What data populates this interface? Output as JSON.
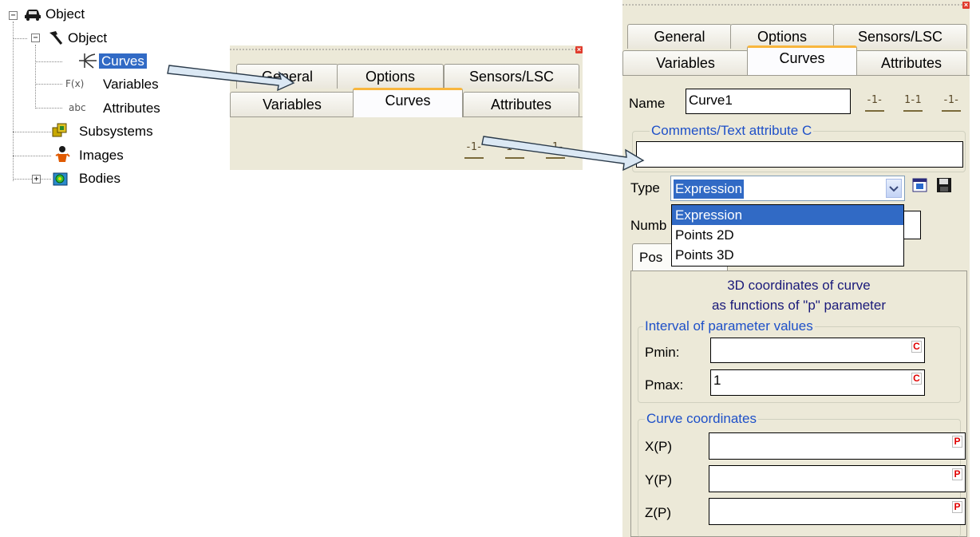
{
  "tree": {
    "nodes": [
      {
        "label": "Object",
        "icon": "car-icon"
      },
      {
        "label": "Object",
        "icon": "hammer-icon"
      },
      {
        "label": "Curves",
        "icon": "curves-icon"
      },
      {
        "label": "Variables",
        "icon": "fx-icon",
        "icon_text": "F(x)"
      },
      {
        "label": "Attributes",
        "icon": "abc-icon",
        "icon_text": "abc"
      },
      {
        "label": "Subsystems",
        "icon": "subsystems-icon"
      },
      {
        "label": "Images",
        "icon": "images-icon"
      },
      {
        "label": "Bodies",
        "icon": "bodies-icon"
      }
    ],
    "expanders": {
      "collapse": "⊟",
      "expand": "+",
      "minus": "−"
    }
  },
  "tabs": {
    "row1": [
      "General",
      "Options",
      "Sensors/LSC"
    ],
    "row2": [
      "Variables",
      "Curves",
      "Attributes"
    ],
    "active": "Curves"
  },
  "toolbar_glyphs": {
    "add": "-1-",
    "add_multi": "1-1",
    "remove": "-1-"
  },
  "close_glyph": "×",
  "form": {
    "name_label": "Name",
    "name_value": "Curve1",
    "comments_title": "Comments/Text attribute C",
    "comments_value": "",
    "type_label": "Type",
    "type_value": "Expression",
    "type_options": [
      "Expression",
      "Points 2D",
      "Points 3D"
    ],
    "number_label_visible": "Numb",
    "subtab_visible": "Pos",
    "description_line1": "3D coordinates of curve",
    "description_line2": "as functions of \"p\" parameter",
    "interval_title": "Interval of parameter values",
    "pmin_label": "Pmin:",
    "pmin_value": "",
    "pmax_label": "Pmax:",
    "pmax_value": "1",
    "c_badge": "C",
    "coords_title": "Curve coordinates",
    "x_label": "X(P)",
    "y_label": "Y(P)",
    "z_label": "Z(P)",
    "p_badge": "P"
  },
  "colors": {
    "selection": "#316ac5",
    "panel": "#ece9d8",
    "group_title": "#1e50c8",
    "active_tab_accent": "#f8b63d",
    "badge_red": "#e00000"
  }
}
